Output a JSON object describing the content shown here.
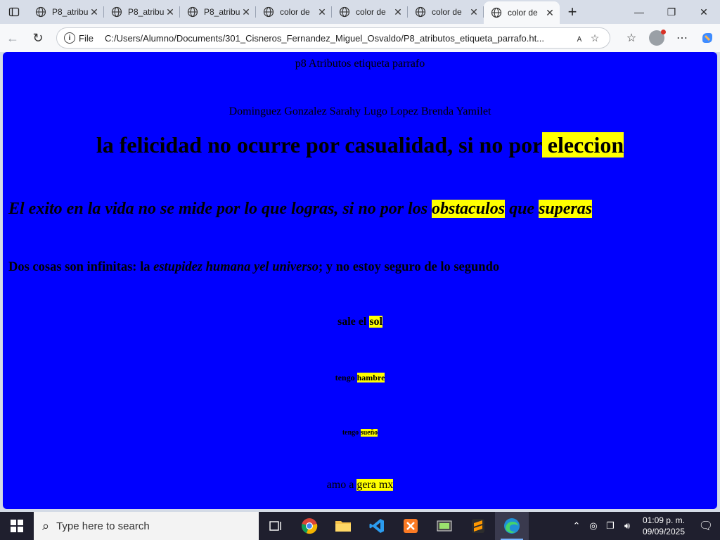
{
  "browser": {
    "tabs": [
      {
        "label": "P8_atribu",
        "active": false
      },
      {
        "label": "P8_atribu",
        "active": false
      },
      {
        "label": "P8_atribu",
        "active": false
      },
      {
        "label": "color de",
        "active": false
      },
      {
        "label": "color de",
        "active": false
      },
      {
        "label": "color de",
        "active": false
      },
      {
        "label": "color de",
        "active": true
      }
    ],
    "address": {
      "scheme_label": "File",
      "url": "C:/Users/Alumno/Documents/301_Cisneros_Fernandez_Miguel_Osvaldo/P8_atributos_etiqueta_parrafo.ht..."
    }
  },
  "page": {
    "background": "#0000ff",
    "highlight": "#ffff00",
    "title": "p8 Atributos etiqueta parrafo",
    "authors": "Dominguez Gonzalez Sarahy Lugo Lopez Brenda Yamilet",
    "heading1": {
      "text": "la felicidad no ocurre por casualidad, si no por",
      "highlight": " eleccion"
    },
    "heading2": {
      "text1": "El exito en la vida no se mide por lo que logras, si no por los ",
      "hl1": "obstaculos",
      "text2": " que ",
      "hl2": "superas"
    },
    "heading3": {
      "text1": "Dos cosas son infinitas: la ",
      "italic": "estupidez humana yel universo",
      "text2": "; y no estoy seguro de lo segundo"
    },
    "line_sol": {
      "text": "sale el ",
      "hl": "sol"
    },
    "line_hambre": {
      "text": "tengo ",
      "hl": "hambre"
    },
    "line_sueno": {
      "text": "tengo ",
      "hl": "sueño"
    },
    "line_gera": {
      "text": "amo a ",
      "hl": "gera mx"
    }
  },
  "taskbar": {
    "search_placeholder": "Type here to search",
    "time": "01:09 p. m.",
    "date": "09/09/2025"
  }
}
